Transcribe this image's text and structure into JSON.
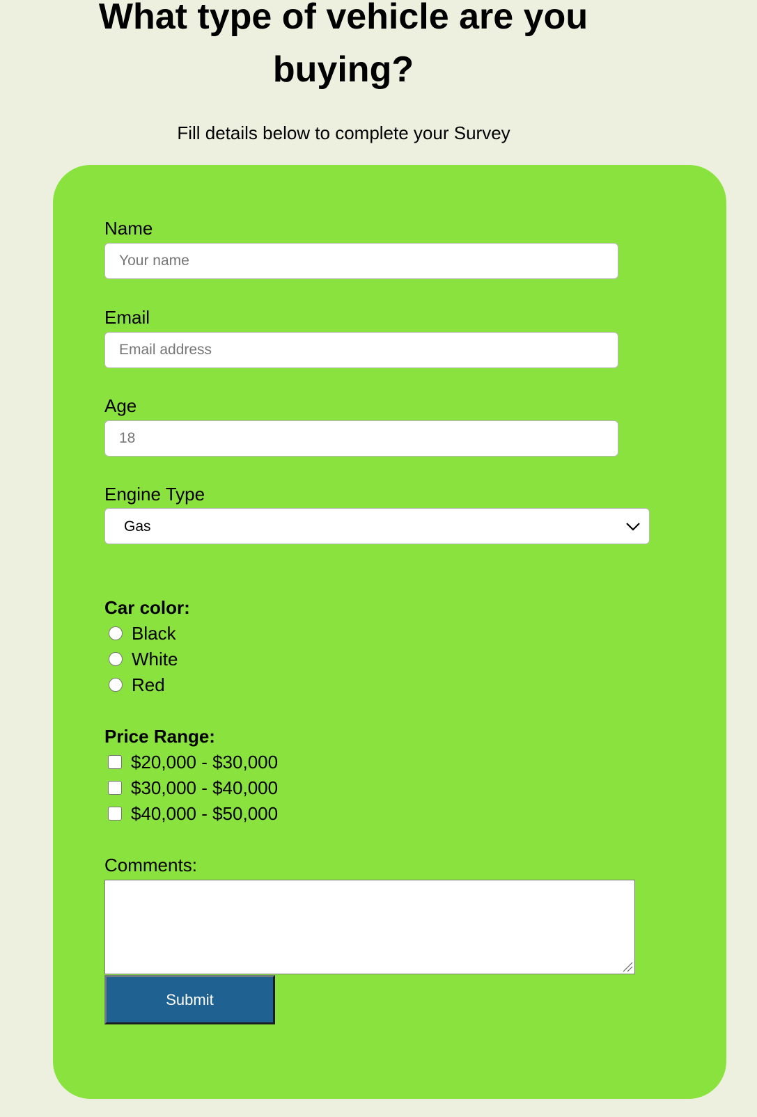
{
  "header": {
    "title": "What type of vehicle are you buying?",
    "subtitle": "Fill details below to complete your Survey"
  },
  "form": {
    "name": {
      "label": "Name",
      "placeholder": "Your name"
    },
    "email": {
      "label": "Email",
      "placeholder": "Email address"
    },
    "age": {
      "label": "Age",
      "placeholder": "18"
    },
    "engine_type": {
      "label": "Engine Type",
      "selected": "Gas"
    },
    "car_color": {
      "label": "Car color:",
      "options": [
        "Black",
        "White",
        "Red"
      ]
    },
    "price_range": {
      "label": "Price Range:",
      "options": [
        "$20,000 - $30,000",
        "$30,000 - $40,000",
        "$40,000 - $50,000"
      ]
    },
    "comments": {
      "label": "Comments:"
    },
    "submit_label": "Submit"
  },
  "colors": {
    "page_background": "#eef0df",
    "card_background": "#8ae23e",
    "submit_background": "#1f6190"
  }
}
